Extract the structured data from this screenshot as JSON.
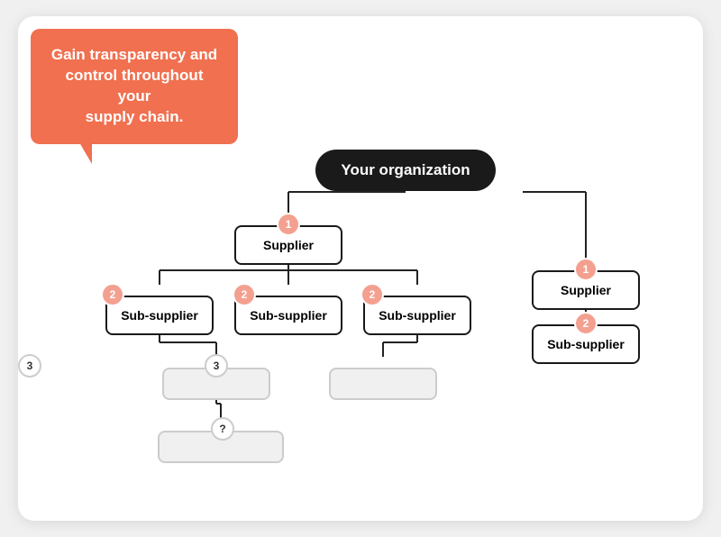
{
  "tooltip": {
    "line1": "Gain transparency and",
    "line2": "control throughout your",
    "line3": "supply chain.",
    "full": "Gain transparency and control throughout your supply chain."
  },
  "nodes": {
    "org": {
      "label": "Your organization"
    },
    "supplier1": {
      "label": "Supplier",
      "badge": "1"
    },
    "supplier2": {
      "label": "Supplier",
      "badge": "1"
    },
    "subsupplier1": {
      "label": "Sub-supplier",
      "badge": "2"
    },
    "subsupplier2": {
      "label": "Sub-supplier",
      "badge": "2"
    },
    "subsupplier3": {
      "label": "Sub-supplier",
      "badge": "2"
    },
    "subsupplier4": {
      "label": "Sub-supplier",
      "badge": "2"
    },
    "tier3_1": {
      "badge": "3"
    },
    "tier3_2": {
      "badge": "3"
    },
    "question": {
      "badge": "?"
    }
  }
}
